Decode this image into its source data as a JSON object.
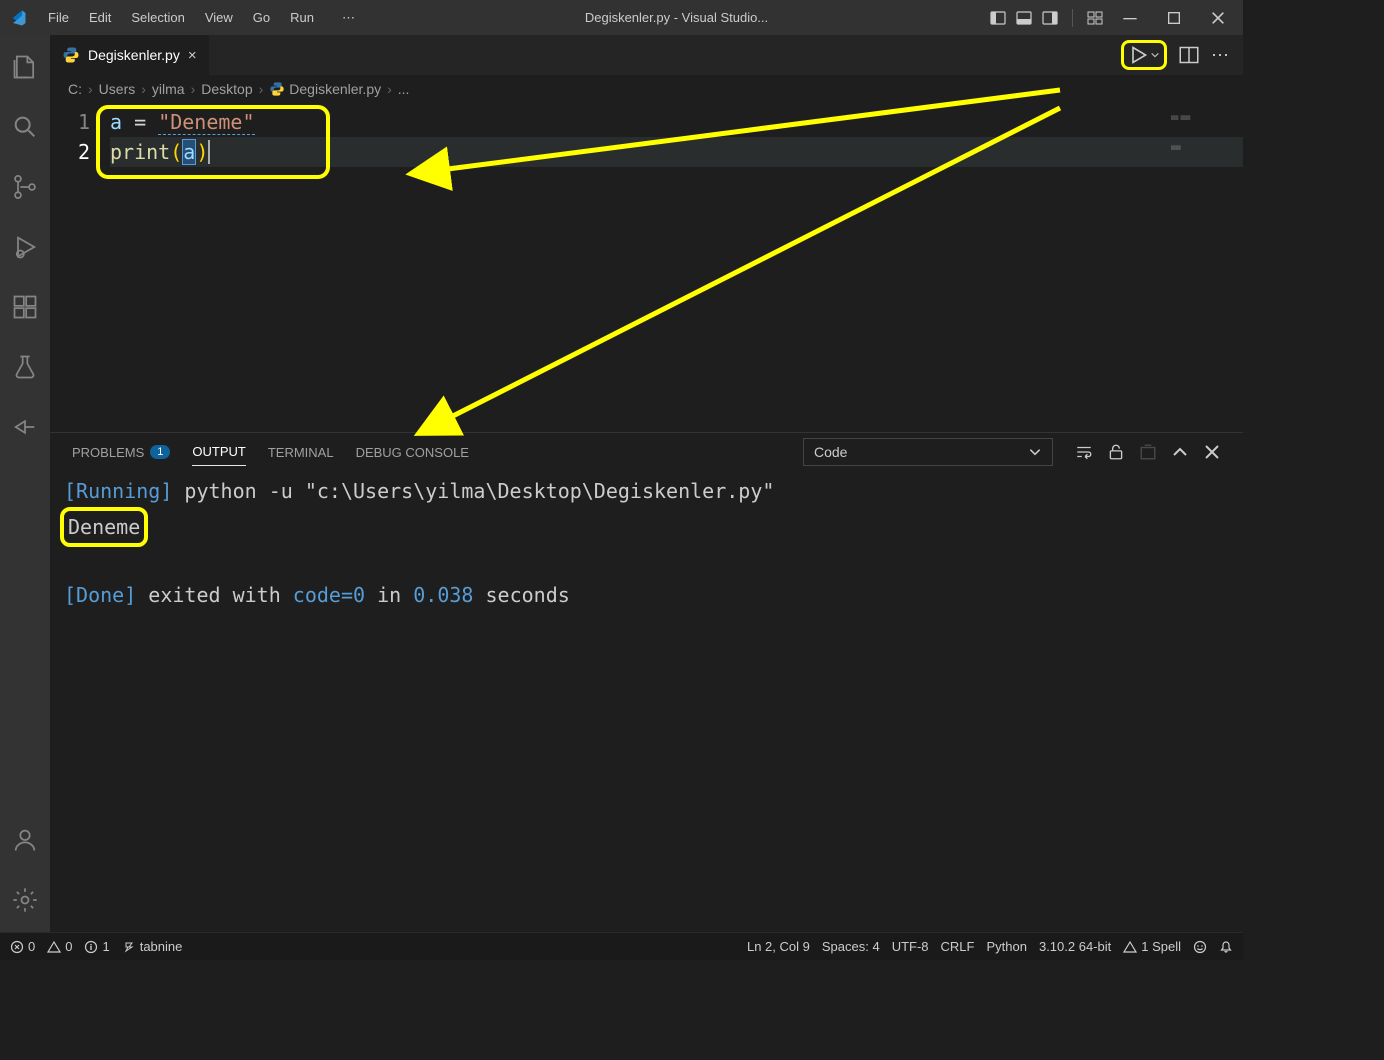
{
  "titlebar": {
    "menus": [
      "File",
      "Edit",
      "Selection",
      "View",
      "Go",
      "Run"
    ],
    "title": "Degiskenler.py - Visual Studio..."
  },
  "tab": {
    "filename": "Degiskenler.py"
  },
  "breadcrumb": {
    "parts": [
      "C:",
      "Users",
      "yilma",
      "Desktop",
      "Degiskenler.py",
      "..."
    ]
  },
  "editor": {
    "line_numbers": [
      "1",
      "2"
    ],
    "line1": {
      "v": "a",
      "op": "=",
      "s": "\"Deneme\""
    },
    "line2": {
      "fn": "print",
      "lp": "(",
      "arg": "a",
      "rp": ")"
    }
  },
  "panel": {
    "tabs": {
      "problems": "PROBLEMS",
      "problems_badge": "1",
      "output": "OUTPUT",
      "terminal": "TERMINAL",
      "debug": "DEBUG CONSOLE"
    },
    "filter_label": "Code",
    "output": {
      "running_tag": "[Running]",
      "running_cmd": " python -u \"c:\\Users\\yilma\\Desktop\\Degiskenler.py\"",
      "value": "Deneme",
      "done_tag": "[Done]",
      "done_text_pre": " exited with ",
      "code_label": "code=",
      "code_val": "0",
      "done_mid": " in ",
      "time_val": "0.038",
      "done_post": " seconds"
    }
  },
  "status": {
    "errors": "0",
    "warnings": "0",
    "info": "1",
    "tabnine": "tabnine",
    "lncol": "Ln 2, Col 9",
    "spaces": "Spaces: 4",
    "enc": "UTF-8",
    "eol": "CRLF",
    "lang": "Python",
    "interp": "3.10.2 64-bit",
    "spell": "1 Spell"
  }
}
